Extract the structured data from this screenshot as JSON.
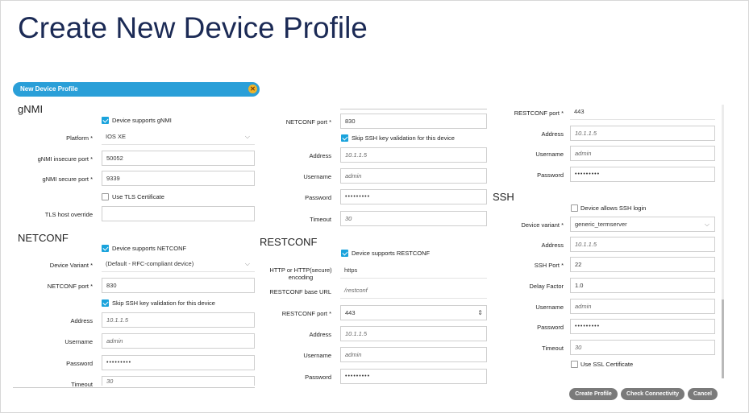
{
  "page_title": "Create New Device Profile",
  "dialog": {
    "title": "New Device Profile",
    "close_icon": "close-icon"
  },
  "gnmi": {
    "section": "gNMI",
    "supports_label": "Device supports gNMI",
    "supports_checked": true,
    "platform_label": "Platform *",
    "platform_value": "IOS XE",
    "insecure_port_label": "gNMI insecure port *",
    "insecure_port_value": "50052",
    "secure_port_label": "gNMI secure port *",
    "secure_port_value": "9339",
    "tls_label": "Use TLS Certificate",
    "tls_checked": false,
    "tls_host_label": "TLS host override",
    "tls_host_value": ""
  },
  "netconf_left": {
    "section": "NETCONF",
    "supports_label": "Device supports NETCONF",
    "supports_checked": true,
    "variant_label": "Device Variant *",
    "variant_value": "(Default - RFC-compliant device)",
    "port_label": "NETCONF port *",
    "port_value": "830",
    "skip_label": "Skip SSH key validation for this device",
    "skip_checked": true,
    "address_label": "Address",
    "address_value": "10.1.1.5",
    "username_label": "Username",
    "username_value": "admin",
    "password_label": "Password",
    "password_value": "•••••••••",
    "timeout_label": "Timeout",
    "timeout_value": "30"
  },
  "netconf_mid": {
    "port_label": "NETCONF port *",
    "port_value": "830",
    "skip_label": "Skip SSH key validation for this device",
    "skip_checked": true,
    "address_label": "Address",
    "address_value": "10.1.1.5",
    "username_label": "Username",
    "username_value": "admin",
    "password_label": "Password",
    "password_value": "•••••••••",
    "timeout_label": "Timeout",
    "timeout_value": "30"
  },
  "restconf": {
    "section": "RESTCONF",
    "supports_label": "Device supports RESTCONF",
    "supports_checked": true,
    "http_label": "HTTP or HTTP(secure) encoding",
    "http_value": "https",
    "base_url_label": "RESTCONF base URL",
    "base_url_value": "/restconf",
    "port_label": "RESTCONF port *",
    "port_value": "443",
    "address_label": "Address",
    "address_value": "10.1.1.5",
    "username_label": "Username",
    "username_value": "admin",
    "password_label": "Password",
    "password_value": "•••••••••"
  },
  "restconf_right": {
    "port_label": "RESTCONF port *",
    "port_value": "443",
    "address_label": "Address",
    "address_value": "10.1.1.5",
    "username_label": "Username",
    "username_value": "admin",
    "password_label": "Password",
    "password_value": "•••••••••"
  },
  "ssh": {
    "section": "SSH",
    "allows_label": "Device allows SSH login",
    "allows_checked": false,
    "variant_label": "Device variant *",
    "variant_value": "generic_termserver",
    "address_label": "Address",
    "address_value": "10.1.1.5",
    "port_label": "SSH Port *",
    "port_value": "22",
    "delay_label": "Delay Factor",
    "delay_value": "1.0",
    "username_label": "Username",
    "username_value": "admin",
    "password_label": "Password",
    "password_value": "•••••••••",
    "timeout_label": "Timeout",
    "timeout_value": "30",
    "ssl_label": "Use SSL Certificate",
    "ssl_checked": false
  },
  "buttons": {
    "create": "Create Profile",
    "check": "Check Connectivity",
    "cancel": "Cancel"
  },
  "colors": {
    "accent": "#2a9fd8",
    "checkbox": "#1aa3dc",
    "title": "#1b2a55",
    "button": "#7a7a7a",
    "close": "#f0b429"
  }
}
